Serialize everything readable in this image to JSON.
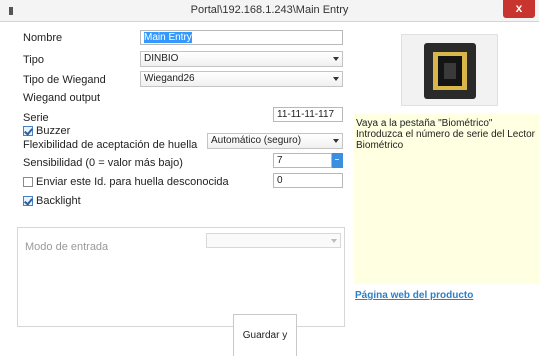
{
  "window": {
    "title": "Portal\\192.168.1.243\\Main Entry",
    "close_glyph": "x"
  },
  "form": {
    "nombre": {
      "label": "Nombre",
      "value": "Main Entry"
    },
    "tipo": {
      "label": "Tipo",
      "value": "DINBIO"
    },
    "tipo_wiegand": {
      "label": "Tipo de Wiegand",
      "value": "Wiegand26"
    },
    "wiegand_output": {
      "label": "Wiegand output"
    },
    "serie": {
      "label": "Serie",
      "value": "11-11-11-117"
    },
    "buzzer": {
      "label": "Buzzer",
      "checked": true
    },
    "flexibilidad": {
      "label": "Flexibilidad de aceptación de huella",
      "value": "Automático (seguro)"
    },
    "sensibilidad": {
      "label": "Sensibilidad (0 = valor más bajo)",
      "value": "7"
    },
    "enviar_id": {
      "label": "Enviar este Id. para huella desconocida",
      "value": "0",
      "checked": false
    },
    "backlight": {
      "label": "Backlight",
      "checked": true
    },
    "modo_entrada": {
      "label": "Modo de entrada",
      "value": ""
    }
  },
  "info": {
    "text": "Vaya a la pestaña \"Biométrico\" Introduzca el número de serie del Lector Biométrico",
    "product_link": "Página web del producto",
    "device_icon": "biometric-reader-icon"
  },
  "actions": {
    "save_label": "Guardar y salir"
  },
  "colors": {
    "close_red": "#c8352f",
    "info_bg": "#ffffe1",
    "link_blue": "#2f7fc7",
    "selection_blue": "#3399ff"
  }
}
